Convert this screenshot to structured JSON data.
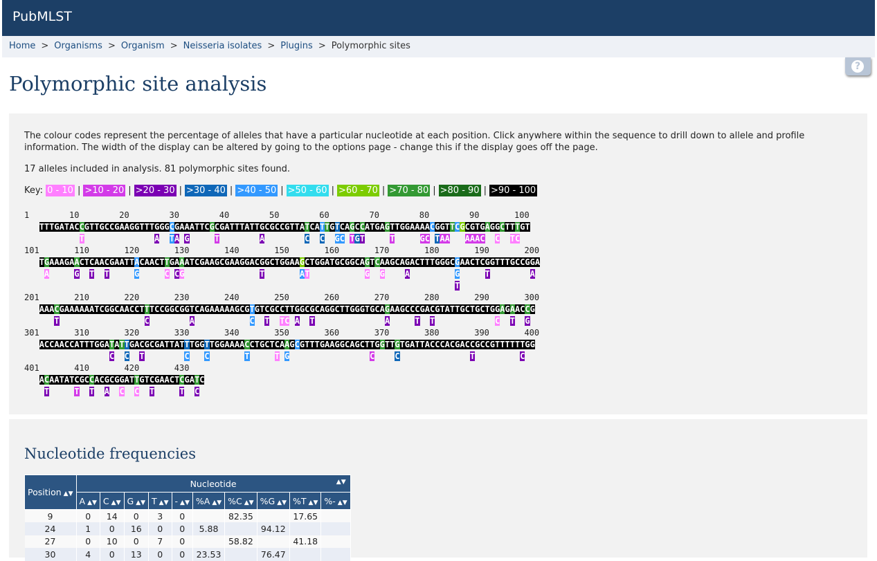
{
  "header": {
    "brand": "PubMLST"
  },
  "breadcrumb": {
    "items": [
      "Home",
      "Organisms",
      "Organism",
      "Neisseria isolates",
      "Plugins"
    ],
    "current": "Polymorphic sites",
    "separator": ">"
  },
  "help": {
    "icon": "help-icon",
    "glyph": "?"
  },
  "page_title": "Polymorphic site analysis",
  "description": "The colour codes represent the percentage of alleles that have a particular nucleotide at each position. Click anywhere within the sequence to drill down to allele and profile information. The width of the display can be altered by going to the options page - change this if the display goes off the page.",
  "summary": "17 alleles included in analysis. 81 polymorphic sites found.",
  "key": {
    "label": "Key:",
    "ranges": [
      {
        "label": "0 - 10",
        "cls": "c1"
      },
      {
        "label": ">10 - 20",
        "cls": "c2"
      },
      {
        "label": ">20 - 30",
        "cls": "c3"
      },
      {
        "label": ">30 - 40",
        "cls": "c4"
      },
      {
        "label": ">40 - 50",
        "cls": "c5"
      },
      {
        "label": ">50 - 60",
        "cls": "c6"
      },
      {
        "label": ">60 - 70",
        "cls": "c7"
      },
      {
        "label": ">70 - 80",
        "cls": "c8"
      },
      {
        "label": ">80 - 90",
        "cls": "c9"
      },
      {
        "label": ">90 - 100",
        "cls": "c10"
      }
    ],
    "separator": "|"
  },
  "sequence_rows": [
    {
      "nums": "1        10        20        30        40        50        60        70        80        90       100",
      "seq": "TTTGATACCGTTGCCGAAGGTTTGGGCGAAATTCGCGATTTATTGCGCCGTTATCATTGTCAGCCATGAGTTGGAAAACGGTTCGCGTGAGGCTTTGT",
      "hl": {
        "9": "c8",
        "27": "c5",
        "35": "c8",
        "54": "c8",
        "57": "c5",
        "58": "c8",
        "60": "c4",
        "63": "c8",
        "65": "c8",
        "70": "c8",
        "79": "c5",
        "83": "c8",
        "84": "c5",
        "85": "c7",
        "90": "c8",
        "93": "c8",
        "96": "c8"
      },
      "var": {
        "9": [
          "T",
          "c1"
        ],
        "24": [
          "A",
          "c3"
        ],
        "27": [
          "T",
          "c5"
        ],
        "28": [
          "A",
          "c3"
        ],
        "30": [
          "G",
          "c3"
        ],
        "36": [
          "T",
          "c2"
        ],
        "45": [
          "A",
          "c3"
        ],
        "54": [
          "C",
          "c4"
        ],
        "57": [
          "C",
          "c4"
        ],
        "60": [
          "G",
          "c5"
        ],
        "61": [
          "C",
          "c5"
        ],
        "63": [
          "T",
          "c2"
        ],
        "64": [
          "G",
          "c4"
        ],
        "65": [
          "T",
          "c3"
        ],
        "71": [
          "T",
          "c2"
        ],
        "77": [
          "G",
          "c2"
        ],
        "78": [
          "C",
          "c2"
        ],
        "80": [
          "T",
          "c4"
        ],
        "81": [
          "A",
          "c2"
        ],
        "82": [
          "A",
          "c2"
        ],
        "86": [
          "A",
          "c2"
        ],
        "87": [
          "A",
          "c2"
        ],
        "88": [
          "A",
          "c2"
        ],
        "89": [
          "C",
          "c2"
        ],
        "92": [
          "C",
          "c1"
        ],
        "95": [
          "T",
          "c1"
        ],
        "96": [
          "C",
          "c1"
        ],
        "99": [
          "A",
          "c3"
        ]
      }
    },
    {
      "nums": "101       110       120       130       140       150       160       170       180       190       200",
      "seq": "TGAAAGAACTCAACGAATTACAACTTGAAATCGAAGCGAAGGACGGCTGGAAGCTGGATGCGGCAGTCAAGCAGACTTTGGGCGAACTCGGTTTGCCGGA",
      "hl": {
        "2": "c8",
        "8": "c8",
        "20": "c5",
        "26": "c8",
        "29": "c8",
        "53": "c7",
        "66": "c8",
        "68": "c8",
        "84": "c5"
      },
      "var": {
        "2": [
          "A",
          "c1"
        ],
        "8": [
          "G",
          "c3"
        ],
        "11": [
          "T",
          "c3"
        ],
        "14": [
          "T",
          "c3"
        ],
        "20": [
          "G",
          "c5"
        ],
        "26": [
          "C",
          "c1"
        ],
        "28": [
          "C",
          "c3"
        ],
        "29": [
          "G",
          "c1"
        ],
        "45": [
          "T",
          "c3"
        ],
        "53": [
          "A",
          "c5"
        ],
        "54": [
          "T",
          "c1"
        ],
        "66": [
          "G",
          "c1"
        ],
        "69": [
          "G",
          "c1"
        ],
        "74": [
          "A",
          "c3"
        ],
        "84": [
          "G",
          "c5"
        ],
        "90": [
          "T",
          "c3"
        ],
        "99": [
          "A",
          "c3"
        ]
      },
      "var2": {
        "84": [
          "T",
          "c3"
        ]
      }
    },
    {
      "nums": "201       210       220       230       240       250       260       270       280       290       300",
      "seq": "AAACGAAAAAATCGGCAACCTTTCCGGCGGTCAGAAAAAGCGTGTCGCCTTGGCGCAGGCTTGGGTGCAGAAGCCCGACGTATTGCTGCTGGAGAACCG",
      "hl": {
        "4": "c8",
        "22": "c8",
        "43": "c5",
        "70": "c8",
        "93": "c8",
        "95": "c8",
        "98": "c8"
      },
      "var": {
        "4": [
          "T",
          "c3"
        ],
        "22": [
          "C",
          "c3"
        ],
        "31": [
          "A",
          "c3"
        ],
        "43": [
          "C",
          "c5"
        ],
        "46": [
          "T",
          "c3"
        ],
        "49": [
          "T",
          "c1"
        ],
        "50": [
          "C",
          "c1"
        ],
        "52": [
          "A",
          "c3"
        ],
        "55": [
          "T",
          "c3"
        ],
        "70": [
          "A",
          "c3"
        ],
        "76": [
          "T",
          "c3"
        ],
        "79": [
          "T",
          "c3"
        ],
        "92": [
          "C",
          "c1"
        ],
        "95": [
          "T",
          "c3"
        ],
        "98": [
          "G",
          "c3"
        ]
      }
    },
    {
      "nums": "301       310       320       330       340       350       360       370       380       390       400",
      "seq": "ACCAACCATTTGGATATTGACGCGATTATTTGGTTGGAAAACCTGCTCAAGCGTTTGAAGGCAGCTTGGTTGTGATTACCCACGACCGCCGTTTTTTGG",
      "hl": {
        "15": "c8",
        "17": "c8",
        "18": "c4",
        "30": "c4",
        "34": "c4",
        "42": "c8",
        "50": "c8",
        "52": "c5",
        "69": "c8",
        "72": "c8"
      },
      "var": {
        "15": [
          "C",
          "c3"
        ],
        "18": [
          "C",
          "c4"
        ],
        "21": [
          "T",
          "c3"
        ],
        "30": [
          "C",
          "c5"
        ],
        "34": [
          "C",
          "c5"
        ],
        "42": [
          "T",
          "c5"
        ],
        "48": [
          "T",
          "c1"
        ],
        "50": [
          "G",
          "c5"
        ],
        "67": [
          "C",
          "c2"
        ],
        "72": [
          "C",
          "c4"
        ],
        "87": [
          "T",
          "c3"
        ],
        "97": [
          "C",
          "c3"
        ]
      }
    },
    {
      "nums": "401       410       420       430",
      "seq": "ACAATATCGCCACGCGGATTGTCGAACTCGATC",
      "hl": {
        "2": "c8",
        "11": "c8",
        "20": "c8",
        "29": "c8",
        "32": "c8"
      },
      "var": {
        "2": [
          "T",
          "c3"
        ],
        "8": [
          "T",
          "c2"
        ],
        "11": [
          "T",
          "c3"
        ],
        "14": [
          "A",
          "c3"
        ],
        "17": [
          "C",
          "c1"
        ],
        "20": [
          "C",
          "c1"
        ],
        "23": [
          "T",
          "c3"
        ],
        "29": [
          "T",
          "c3"
        ],
        "32": [
          "C",
          "c3"
        ]
      }
    }
  ],
  "freq": {
    "title": "Nucleotide frequencies",
    "headers": {
      "position": "Position",
      "nucleotide": "Nucleotide",
      "cols": [
        "A",
        "C",
        "G",
        "T",
        "-",
        "%A",
        "%C",
        "%G",
        "%T",
        "%-"
      ]
    },
    "rows": [
      [
        "9",
        "0",
        "14",
        "0",
        "3",
        "0",
        "",
        "82.35",
        "",
        "17.65",
        ""
      ],
      [
        "24",
        "1",
        "0",
        "16",
        "0",
        "0",
        "5.88",
        "",
        "94.12",
        "",
        ""
      ],
      [
        "27",
        "0",
        "10",
        "0",
        "7",
        "0",
        "",
        "58.82",
        "",
        "41.18",
        ""
      ],
      [
        "30",
        "4",
        "0",
        "13",
        "0",
        "0",
        "23.53",
        "",
        "76.47",
        "",
        ""
      ]
    ]
  }
}
